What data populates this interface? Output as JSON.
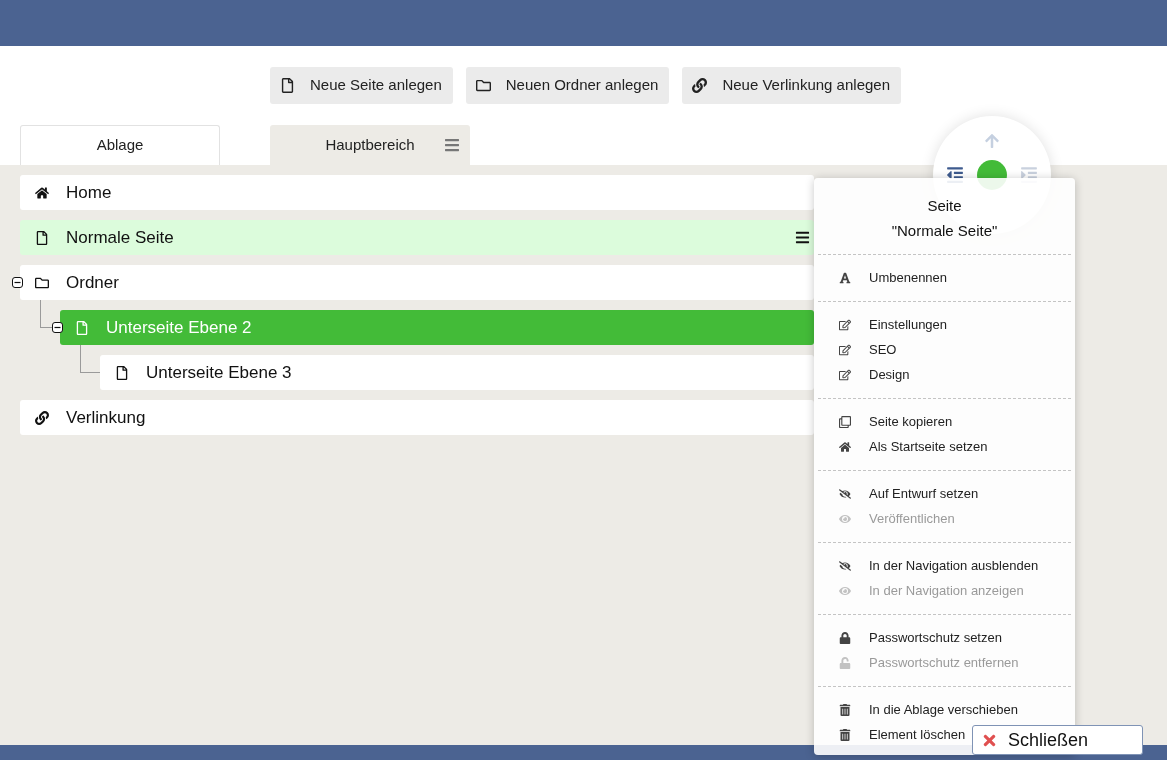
{
  "toolbar": {
    "buttons": [
      {
        "label": "Neue Seite anlegen",
        "kind": "page"
      },
      {
        "label": "Neuen Ordner anlegen",
        "kind": "folder"
      },
      {
        "label": "Neue Verlinkung anlegen",
        "kind": "link"
      }
    ]
  },
  "tabs": [
    {
      "label": "Ablage",
      "selected": false
    },
    {
      "label": "Hauptbereich",
      "selected": true
    }
  ],
  "tree": {
    "items": [
      {
        "label": "Home",
        "kind": "home",
        "selected": false,
        "menu_open": false
      },
      {
        "label": "Normale Seite",
        "kind": "page",
        "selected": false,
        "menu_open": true
      },
      {
        "label": "Ordner",
        "kind": "folder",
        "selected": false,
        "menu_open": false,
        "expanded": true,
        "children": [
          {
            "label": "Unterseite Ebene 2",
            "kind": "page",
            "selected": true,
            "menu_open": false,
            "expanded": true,
            "children": [
              {
                "label": "Unterseite Ebene 3",
                "kind": "page",
                "selected": false,
                "menu_open": false
              }
            ]
          }
        ]
      },
      {
        "label": "Verlinkung",
        "kind": "link",
        "selected": false,
        "menu_open": false
      }
    ]
  },
  "context_menu": {
    "title": "Seite",
    "subtitle": "\"Normale Seite\"",
    "groups": [
      {
        "items": [
          {
            "label": "Umbenennen",
            "kind": "rename",
            "disabled": false
          }
        ]
      },
      {
        "items": [
          {
            "label": "Einstellungen",
            "kind": "edit",
            "disabled": false
          },
          {
            "label": "SEO",
            "kind": "edit",
            "disabled": false
          },
          {
            "label": "Design",
            "kind": "edit",
            "disabled": false
          }
        ]
      },
      {
        "items": [
          {
            "label": "Seite kopieren",
            "kind": "copy",
            "disabled": false
          },
          {
            "label": "Als Startseite setzen",
            "kind": "start",
            "disabled": false
          }
        ]
      },
      {
        "items": [
          {
            "label": "Auf Entwurf setzen",
            "kind": "hide",
            "disabled": false
          },
          {
            "label": "Veröffentlichen",
            "kind": "show",
            "disabled": true
          }
        ]
      },
      {
        "items": [
          {
            "label": "In der Navigation ausblenden",
            "kind": "hide",
            "disabled": false
          },
          {
            "label": "In der Navigation anzeigen",
            "kind": "show",
            "disabled": true
          }
        ]
      },
      {
        "items": [
          {
            "label": "Passwortschutz setzen",
            "kind": "lock",
            "disabled": false
          },
          {
            "label": "Passwortschutz entfernen",
            "kind": "unlock",
            "disabled": true
          }
        ]
      },
      {
        "items": [
          {
            "label": "In die Ablage verschieben",
            "kind": "delete",
            "disabled": false
          },
          {
            "label": "Element löschen",
            "kind": "delete",
            "disabled": false
          }
        ]
      }
    ]
  },
  "close_button": {
    "label": "Schließen"
  }
}
